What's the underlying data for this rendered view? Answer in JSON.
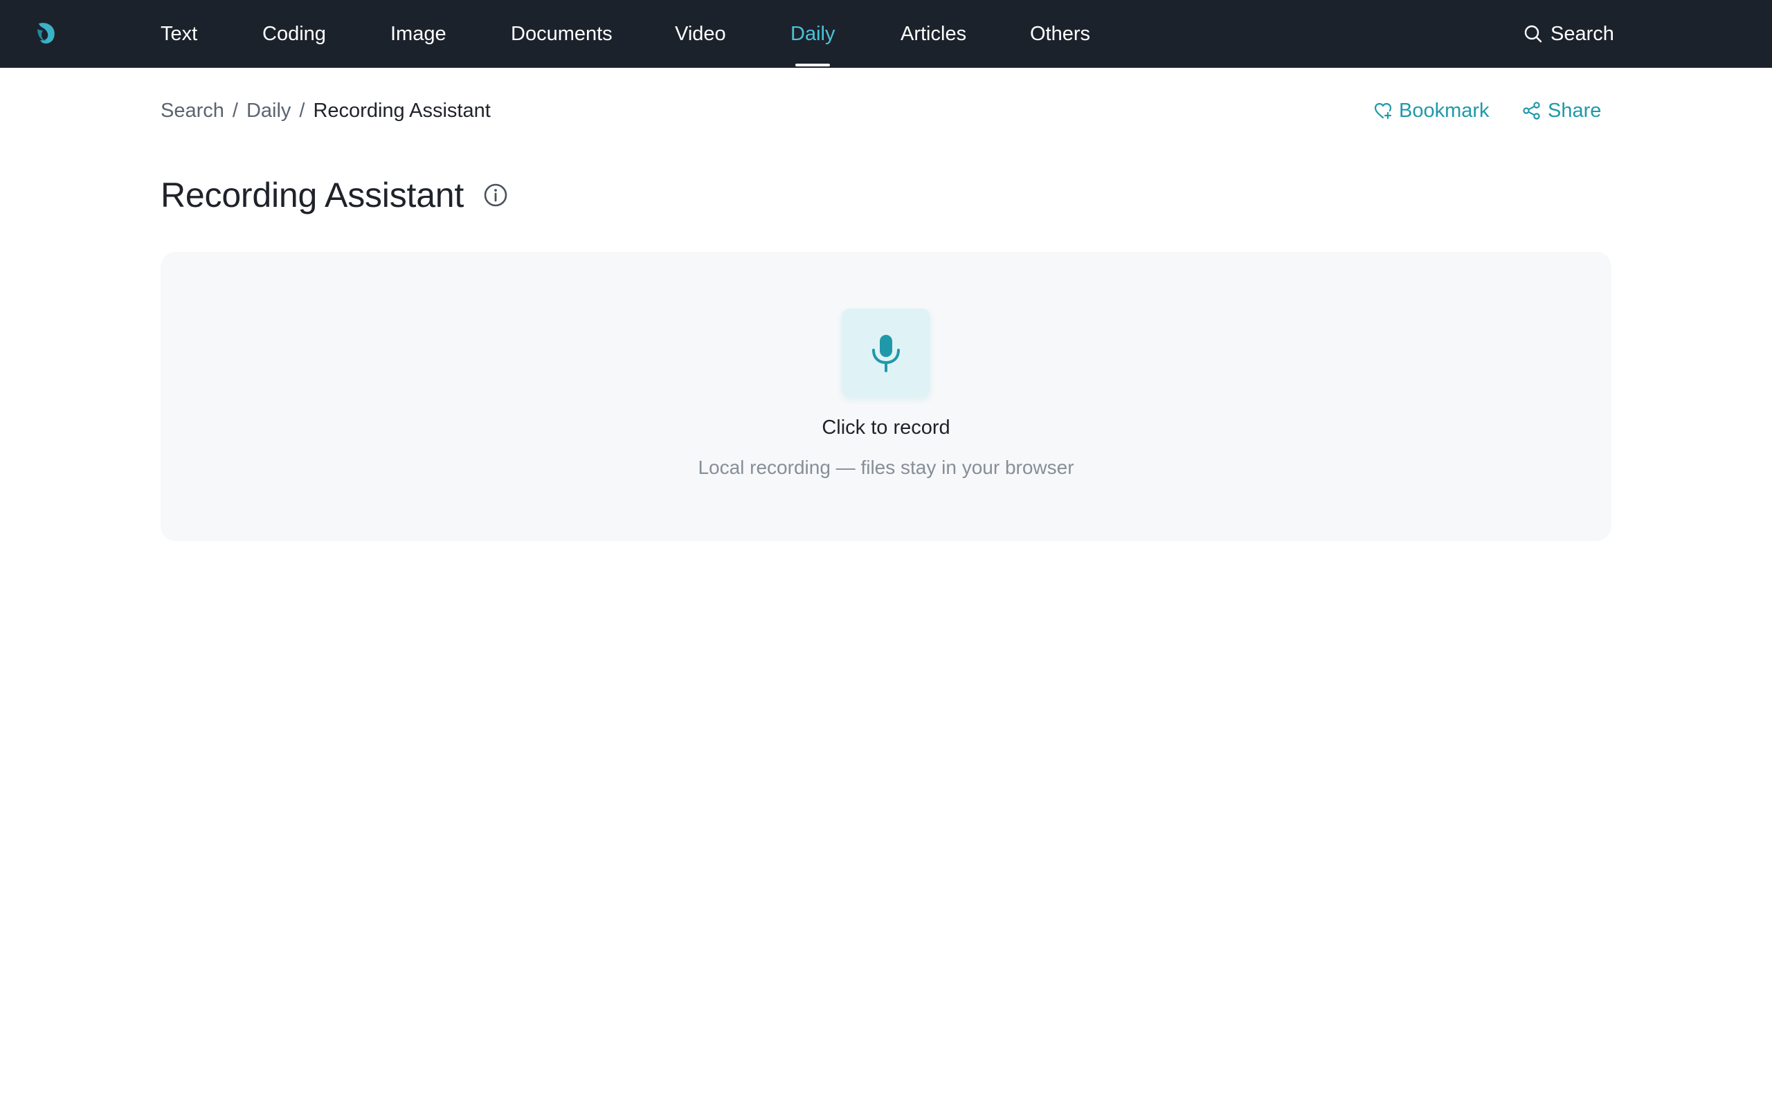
{
  "nav": {
    "items": [
      {
        "label": "Text"
      },
      {
        "label": "Coding"
      },
      {
        "label": "Image"
      },
      {
        "label": "Documents"
      },
      {
        "label": "Video"
      },
      {
        "label": "Daily",
        "active": true
      },
      {
        "label": "Articles"
      },
      {
        "label": "Others"
      }
    ],
    "search_label": "Search",
    "colors": {
      "background": "#1c222c",
      "active": "#4cc3d6"
    }
  },
  "breadcrumb": {
    "items": [
      "Search",
      "Daily",
      "Recording Assistant"
    ],
    "separator": "/"
  },
  "actions": {
    "bookmark_label": "Bookmark",
    "share_label": "Share",
    "color": "#1f99aa"
  },
  "page": {
    "title": "Recording Assistant"
  },
  "recorder": {
    "title": "Click to record",
    "subtitle": "Local recording — files stay in your browser",
    "icon": "microphone-icon"
  }
}
